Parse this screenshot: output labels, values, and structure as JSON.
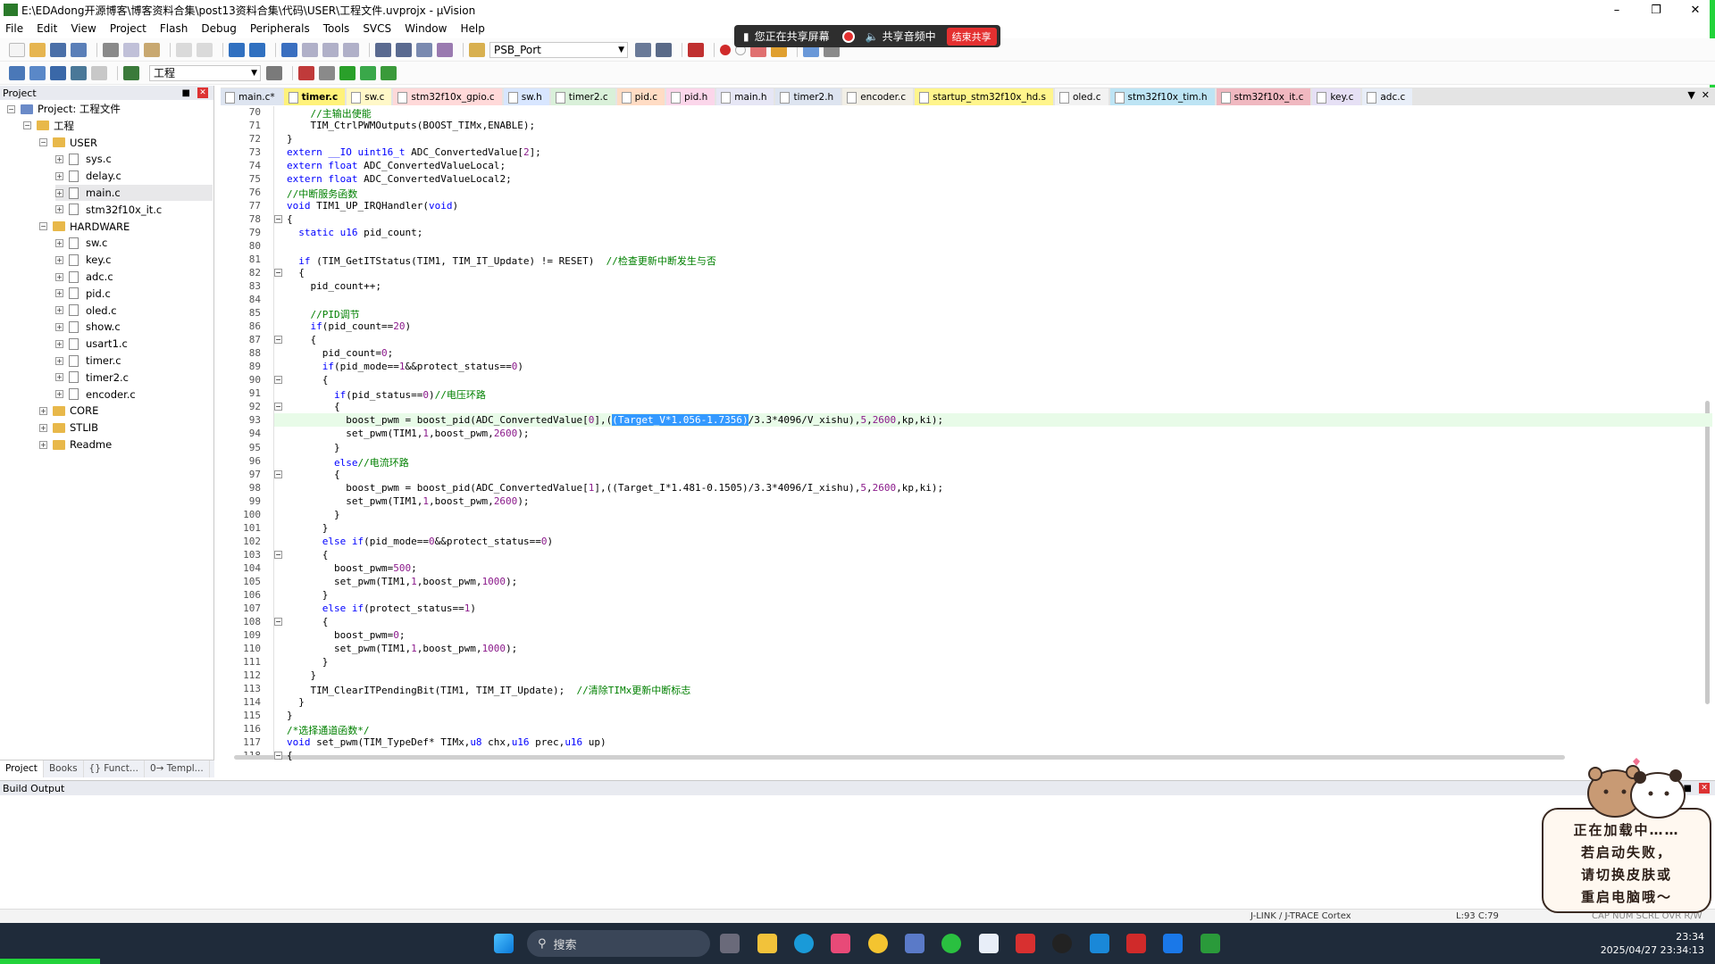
{
  "window": {
    "title": "E:\\EDAdong开源博客\\博客资料合集\\post13资料合集\\代码\\USER\\工程文件.uvprojx - µVision"
  },
  "menu": [
    "File",
    "Edit",
    "View",
    "Project",
    "Flash",
    "Debug",
    "Peripherals",
    "Tools",
    "SVCS",
    "Window",
    "Help"
  ],
  "toolbar": {
    "target_combo": "PSB_Port",
    "project_combo": "工程"
  },
  "share_banner": {
    "sharing_text": "您正在共享屏幕",
    "audio_text": "共享音频中",
    "end_label": "结束共享"
  },
  "project_panel": {
    "title": "Project",
    "root": "Project: 工程文件",
    "group": "工程",
    "folders": [
      {
        "name": "USER",
        "files": [
          "sys.c",
          "delay.c",
          "main.c",
          "stm32f10x_it.c"
        ]
      },
      {
        "name": "HARDWARE",
        "files": [
          "sw.c",
          "key.c",
          "adc.c",
          "pid.c",
          "oled.c",
          "show.c",
          "usart1.c",
          "timer.c",
          "timer2.c",
          "encoder.c"
        ]
      },
      {
        "name": "CORE"
      },
      {
        "name": "STLIB"
      },
      {
        "name": "Readme"
      }
    ],
    "tabs": [
      "Project",
      "Books",
      "{} Funct...",
      "0→ Templ..."
    ]
  },
  "editor_tabs": [
    {
      "label": "main.c*",
      "color": "#dde4f0"
    },
    {
      "label": "timer.c",
      "color": "#fff27a",
      "active": true
    },
    {
      "label": "sw.c",
      "color": "#fff8c8"
    },
    {
      "label": "stm32f10x_gpio.c",
      "color": "#ffd9d9"
    },
    {
      "label": "sw.h",
      "color": "#d8e6ff"
    },
    {
      "label": "timer2.c",
      "color": "#d9f0d9"
    },
    {
      "label": "pid.c",
      "color": "#ffdcc4"
    },
    {
      "label": "pid.h",
      "color": "#fbd6ea"
    },
    {
      "label": "main.h",
      "color": "#e6e6f5"
    },
    {
      "label": "timer2.h",
      "color": "#dde4f0"
    },
    {
      "label": "encoder.c",
      "color": "#f2efe6"
    },
    {
      "label": "startup_stm32f10x_hd.s",
      "color": "#fff58c"
    },
    {
      "label": "oled.c",
      "color": "#f2f2f2"
    },
    {
      "label": "stm32f10x_tim.h",
      "color": "#bde4f4"
    },
    {
      "label": "stm32f10x_it.c",
      "color": "#f0b8c0"
    },
    {
      "label": "key.c",
      "color": "#e6e0f5"
    },
    {
      "label": "adc.c",
      "color": "#e8eef8"
    }
  ],
  "code_lines": [
    {
      "n": "70",
      "t": "    //主输出使能"
    },
    {
      "n": "71",
      "t": "    TIM_CtrlPWMOutputs(BOOST_TIMx,ENABLE);"
    },
    {
      "n": "72",
      "t": "}"
    },
    {
      "n": "73",
      "t": "extern __IO uint16_t ADC_ConvertedValue[2];"
    },
    {
      "n": "74",
      "t": "extern float ADC_ConvertedValueLocal;"
    },
    {
      "n": "75",
      "t": "extern float ADC_ConvertedValueLocal2;"
    },
    {
      "n": "76",
      "t": "//中断服务函数"
    },
    {
      "n": "77",
      "t": "void TIM1_UP_IRQHandler(void)"
    },
    {
      "n": "78",
      "t": "{"
    },
    {
      "n": "79",
      "t": "  static u16 pid_count;"
    },
    {
      "n": "80",
      "t": ""
    },
    {
      "n": "81",
      "t": "  if (TIM_GetITStatus(TIM1, TIM_IT_Update) != RESET)  //检查更新中断发生与否"
    },
    {
      "n": "82",
      "t": "  {"
    },
    {
      "n": "83",
      "t": "    pid_count++;"
    },
    {
      "n": "84",
      "t": ""
    },
    {
      "n": "85",
      "t": "    //PID调节"
    },
    {
      "n": "86",
      "t": "    if(pid_count==20)"
    },
    {
      "n": "87",
      "t": "    {"
    },
    {
      "n": "88",
      "t": "      pid_count=0;"
    },
    {
      "n": "89",
      "t": "      if(pid_mode==1&&protect_status==0)"
    },
    {
      "n": "90",
      "t": "      {"
    },
    {
      "n": "91",
      "t": "        if(pid_status==0)//电压环路"
    },
    {
      "n": "92",
      "t": "        {"
    },
    {
      "n": "93",
      "t": "          boost_pwm = boost_pid(ADC_ConvertedValue[0],((Target_V*1.056-1.7356)/3.3*4096/V_xishu),5,2600,kp,ki);"
    },
    {
      "n": "94",
      "t": "          set_pwm(TIM1,1,boost_pwm,2600);"
    },
    {
      "n": "95",
      "t": "        }"
    },
    {
      "n": "96",
      "t": "        else//电流环路"
    },
    {
      "n": "97",
      "t": "        {"
    },
    {
      "n": "98",
      "t": "          boost_pwm = boost_pid(ADC_ConvertedValue[1],((Target_I*1.481-0.1505)/3.3*4096/I_xishu),5,2600,kp,ki);"
    },
    {
      "n": "99",
      "t": "          set_pwm(TIM1,1,boost_pwm,2600);"
    },
    {
      "n": "100",
      "t": "        }"
    },
    {
      "n": "101",
      "t": "      }"
    },
    {
      "n": "102",
      "t": "      else if(pid_mode==0&&protect_status==0)"
    },
    {
      "n": "103",
      "t": "      {"
    },
    {
      "n": "104",
      "t": "        boost_pwm=500;"
    },
    {
      "n": "105",
      "t": "        set_pwm(TIM1,1,boost_pwm,1000);"
    },
    {
      "n": "106",
      "t": "      }"
    },
    {
      "n": "107",
      "t": "      else if(protect_status==1)"
    },
    {
      "n": "108",
      "t": "      {"
    },
    {
      "n": "109",
      "t": "        boost_pwm=0;"
    },
    {
      "n": "110",
      "t": "        set_pwm(TIM1,1,boost_pwm,1000);"
    },
    {
      "n": "111",
      "t": "      }"
    },
    {
      "n": "112",
      "t": "    }"
    },
    {
      "n": "113",
      "t": "    TIM_ClearITPendingBit(TIM1, TIM_IT_Update);  //清除TIMx更新中断标志"
    },
    {
      "n": "114",
      "t": "  }"
    },
    {
      "n": "115",
      "t": "}"
    },
    {
      "n": "116",
      "t": "/*选择通道函数*/"
    },
    {
      "n": "117",
      "t": "void set_pwm(TIM_TypeDef* TIMx,u8 chx,u16 prec,u16 up)"
    },
    {
      "n": "118",
      "t": "{"
    }
  ],
  "selection_text": "(Target_V*1.056-1.7356)",
  "build_output": {
    "title": "Build Output"
  },
  "status_bar": {
    "debugger": "J-LINK / J-TRACE Cortex",
    "position": "L:93 C:79",
    "flags": "CAP NUM SCRL OVR R/W"
  },
  "sticker": {
    "lines": [
      "正在加载中……",
      "若启动失败，",
      "请切换皮肤或",
      "重启电脑哦～"
    ]
  },
  "taskbar": {
    "search_placeholder": "搜索",
    "time": "23:34",
    "datetime": "2025/04/27 23:34:13"
  }
}
